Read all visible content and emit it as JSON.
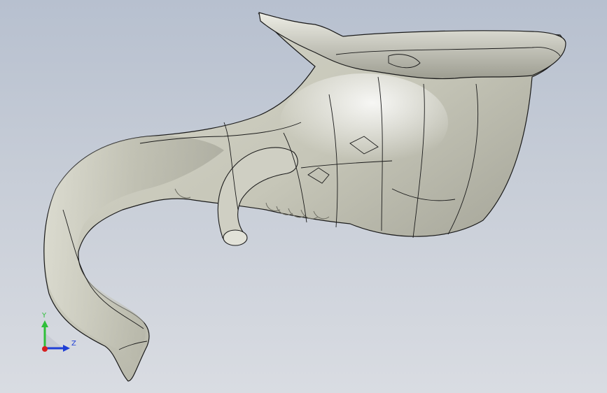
{
  "viewport": {
    "background_top": "#b7c0cf",
    "background_bottom": "#d9dce2",
    "model_fill": "#c9c9bb",
    "model_shadow": "#8f8f84",
    "edge_color": "#1a1a1a"
  },
  "triad": {
    "y_label": "Y",
    "z_label": "Z",
    "y_color": "#2fbf3a",
    "z_color": "#1f3fd6",
    "x_color": "#d62020"
  }
}
